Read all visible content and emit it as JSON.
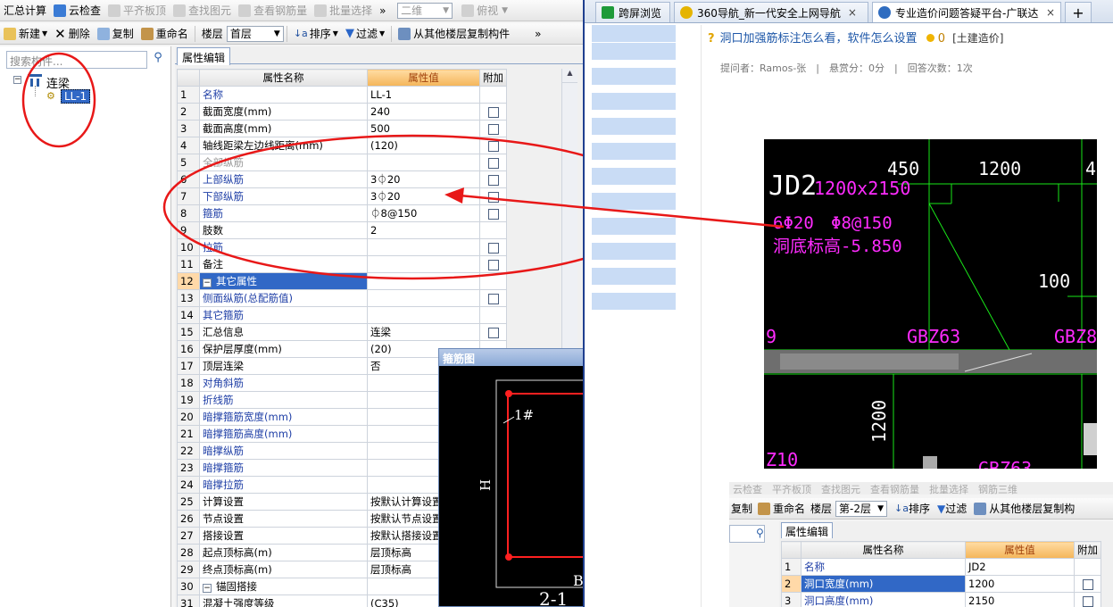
{
  "toolbar1": {
    "items": [
      "汇总计算",
      "云检查",
      "平齐板顶",
      "查找图元",
      "查看钢筋量",
      "批量选择"
    ],
    "view_mode": "二维",
    "view_angle": "俯视",
    "overflow": "»"
  },
  "toolbar2": {
    "new": "新建",
    "delete": "删除",
    "copy": "复制",
    "rename": "重命名",
    "floor_label": "楼层",
    "floor_value": "首层",
    "sort": "排序",
    "filter": "过滤",
    "copy_from_floor": "从其他楼层复制构件",
    "overflow": "»"
  },
  "tree": {
    "search_placeholder": "搜索构件...",
    "root": "连梁",
    "child": "LL-1",
    "collapse": "−"
  },
  "props": {
    "tab": "属性编辑",
    "headers": {
      "name": "属性名称",
      "value": "属性值",
      "extra": "附加"
    },
    "rows": [
      {
        "n": "1",
        "name": "名称",
        "value": "LL-1",
        "check": false,
        "style": "blue"
      },
      {
        "n": "2",
        "name": "截面宽度(mm)",
        "value": "240",
        "check": true,
        "style": ""
      },
      {
        "n": "3",
        "name": "截面高度(mm)",
        "value": "500",
        "check": true,
        "style": ""
      },
      {
        "n": "4",
        "name": "轴线距梁左边线距离(mm)",
        "value": "(120)",
        "check": true,
        "style": ""
      },
      {
        "n": "5",
        "name": "全部纵筋",
        "value": "",
        "check": true,
        "style": "gray"
      },
      {
        "n": "6",
        "name": "上部纵筋",
        "value": "3⏀20",
        "check": true,
        "style": "blue"
      },
      {
        "n": "7",
        "name": "下部纵筋",
        "value": "3⏀20",
        "check": true,
        "style": "blue"
      },
      {
        "n": "8",
        "name": "箍筋",
        "value": "⏀8@150",
        "check": true,
        "style": "blue"
      },
      {
        "n": "9",
        "name": "肢数",
        "value": "2",
        "check": false,
        "style": ""
      },
      {
        "n": "10",
        "name": "拉筋",
        "value": "",
        "check": true,
        "style": "blue"
      },
      {
        "n": "11",
        "name": "备注",
        "value": "",
        "check": true,
        "style": ""
      },
      {
        "n": "12",
        "name": "其它属性",
        "value": "",
        "check": false,
        "style": "group",
        "expander": "−"
      },
      {
        "n": "13",
        "name": "侧面纵筋(总配筋值)",
        "value": "",
        "check": true,
        "style": "blue-ind"
      },
      {
        "n": "14",
        "name": "其它箍筋",
        "value": "",
        "check": false,
        "style": "blue-ind"
      },
      {
        "n": "15",
        "name": "汇总信息",
        "value": "连梁",
        "check": true,
        "style": "ind"
      },
      {
        "n": "16",
        "name": "保护层厚度(mm)",
        "value": "(20)",
        "check": false,
        "style": "ind"
      },
      {
        "n": "17",
        "name": "顶层连梁",
        "value": "否",
        "check": false,
        "style": "ind"
      },
      {
        "n": "18",
        "name": "对角斜筋",
        "value": "",
        "check": false,
        "style": "blue-ind"
      },
      {
        "n": "19",
        "name": "折线筋",
        "value": "",
        "check": false,
        "style": "blue-ind"
      },
      {
        "n": "20",
        "name": "暗撑箍筋宽度(mm)",
        "value": "",
        "check": false,
        "style": "blue-ind"
      },
      {
        "n": "21",
        "name": "暗撑箍筋高度(mm)",
        "value": "",
        "check": false,
        "style": "blue-ind"
      },
      {
        "n": "22",
        "name": "暗撑纵筋",
        "value": "",
        "check": false,
        "style": "blue-ind"
      },
      {
        "n": "23",
        "name": "暗撑箍筋",
        "value": "",
        "check": false,
        "style": "blue-ind"
      },
      {
        "n": "24",
        "name": "暗撑拉筋",
        "value": "",
        "check": false,
        "style": "blue-ind"
      },
      {
        "n": "25",
        "name": "计算设置",
        "value": "按默认计算设置",
        "check": false,
        "style": "ind"
      },
      {
        "n": "26",
        "name": "节点设置",
        "value": "按默认节点设置",
        "check": false,
        "style": "ind"
      },
      {
        "n": "27",
        "name": "搭接设置",
        "value": "按默认搭接设置",
        "check": false,
        "style": "ind"
      },
      {
        "n": "28",
        "name": "起点顶标高(m)",
        "value": "层顶标高",
        "check": false,
        "style": "ind"
      },
      {
        "n": "29",
        "name": "终点顶标高(m)",
        "value": "层顶标高",
        "check": false,
        "style": "ind"
      },
      {
        "n": "30",
        "name": "锚固搭接",
        "value": "",
        "check": false,
        "style": "group2",
        "expander": "−"
      },
      {
        "n": "31",
        "name": "混凝土强度等级",
        "value": "(C35)",
        "check": false,
        "style": "ind"
      }
    ]
  },
  "stirrup_window": {
    "title": "箍筋图",
    "label_h": "H",
    "label_1": "1#",
    "label_b": "B",
    "label_bottom": "2-1"
  },
  "browser": {
    "tabs": [
      {
        "label": "跨屏浏览",
        "icon_color": "#1f9b3a"
      },
      {
        "label": "360导航_新一代安全上网导航",
        "icon_color": "#e5b400",
        "close": "×"
      },
      {
        "label": "专业造价问题答疑平台-广联达服",
        "icon_color": "#2e6cc0",
        "close": "×"
      },
      {
        "label": "+",
        "icon_color": ""
      }
    ],
    "question_title": "洞口加强筋标注怎么看，软件怎么设置",
    "reward_amount": "0",
    "category": "[土建造价]",
    "meta": "提问者：Ramos-张　|　悬赏分：0分　|　回答次数：1次"
  },
  "cad": {
    "labels": [
      "JD2",
      "1200x2150",
      "450",
      "1200",
      "4",
      "6Φ20",
      "Φ8@150",
      "洞底标高-5.850",
      "100",
      "9",
      "GBZ63",
      "GBZ8",
      "1200",
      "Z10",
      "GBZ63"
    ]
  },
  "inner_app": {
    "toolbar1": [
      "云检查",
      "平齐板顶",
      "查找图元",
      "查看钢筋量",
      "批量选择",
      "钢筋三维"
    ],
    "copy": "复制",
    "rename": "重命名",
    "floor_label": "楼层",
    "floor_value": "第-2层",
    "sort": "排序",
    "filter": "过滤",
    "copy_from_floor": "从其他楼层复制构",
    "tab": "属性编辑",
    "headers": {
      "name": "属性名称",
      "value": "属性值",
      "extra": "附加"
    },
    "rows": [
      {
        "n": "1",
        "name": "名称",
        "value": "JD2",
        "check": false
      },
      {
        "n": "2",
        "name": "洞口宽度(mm)",
        "value": "1200",
        "check": true
      },
      {
        "n": "3",
        "name": "洞口高度(mm)",
        "value": "2150",
        "check": true
      }
    ]
  },
  "colors": {
    "annotation_red": "#e81818",
    "cad_green": "#19e619",
    "cad_magenta": "#ff2bff",
    "selection_blue": "#3168c6",
    "header_orange": "#f4b559"
  }
}
